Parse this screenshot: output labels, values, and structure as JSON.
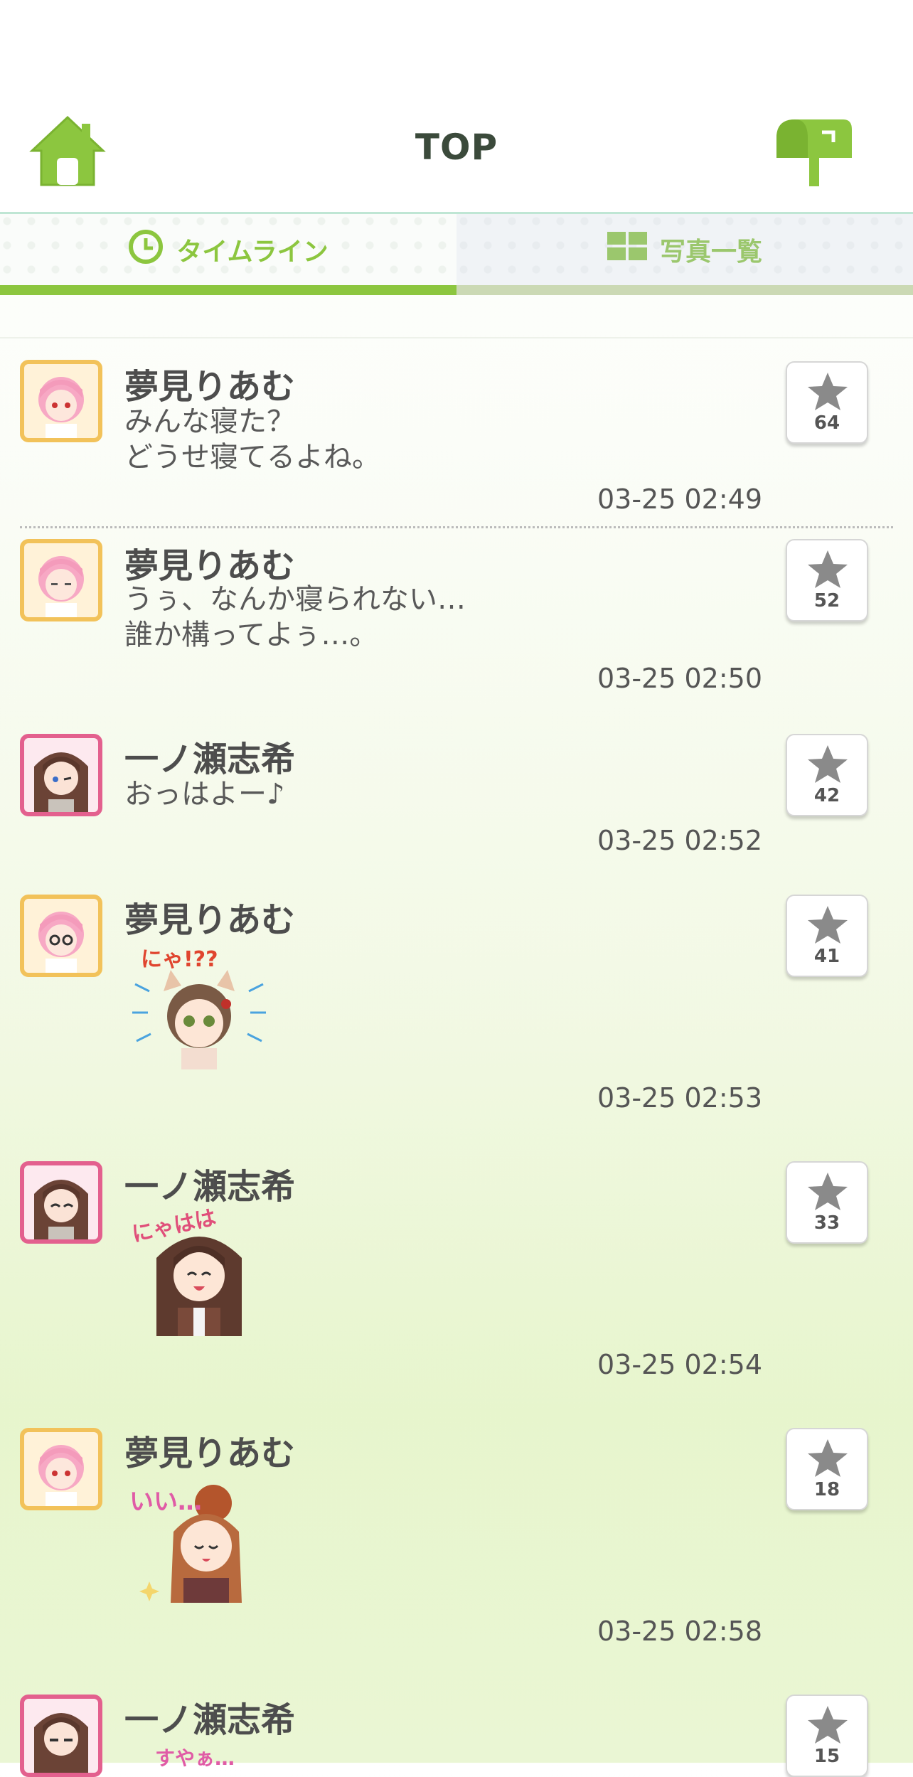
{
  "header": {
    "title": "TOP",
    "home_icon": "home-icon",
    "mail_icon": "mailbox-icon"
  },
  "tabs": [
    {
      "label": "タイムライン",
      "icon": "clock-icon",
      "active": true
    },
    {
      "label": "写真一覧",
      "icon": "grid-icon",
      "active": false
    }
  ],
  "colors": {
    "accent": "#8cc63f",
    "riamu_frame": "#f2c25a",
    "shiki_frame": "#e3608e"
  },
  "posts": [
    {
      "name": "夢見りあむ",
      "text": "みんな寝た？\nどうせ寝てるよね。",
      "time": "03-25 02:49",
      "stars": "64",
      "avatar": "riamu-avatar"
    },
    {
      "name": "夢見りあむ",
      "text": "うぅ、なんか寝られない…\n誰か構ってよぅ…。",
      "time": "03-25 02:50",
      "stars": "52",
      "avatar": "riamu-avatar"
    },
    {
      "name": "一ノ瀬志希",
      "text": "おっはよー♪",
      "time": "03-25 02:52",
      "stars": "42",
      "avatar": "shiki-avatar"
    },
    {
      "name": "夢見りあむ",
      "sticker_text": "にゃ!??",
      "time": "03-25 02:53",
      "stars": "41",
      "avatar": "riamu-avatar"
    },
    {
      "name": "一ノ瀬志希",
      "sticker_text": "にゃはは",
      "time": "03-25 02:54",
      "stars": "33",
      "avatar": "shiki-avatar"
    },
    {
      "name": "夢見りあむ",
      "sticker_text": "いい…",
      "time": "03-25 02:58",
      "stars": "18",
      "avatar": "riamu-avatar"
    },
    {
      "name": "一ノ瀬志希",
      "sticker_text": "すやぁ…",
      "stars": "15",
      "avatar": "shiki-avatar"
    }
  ]
}
